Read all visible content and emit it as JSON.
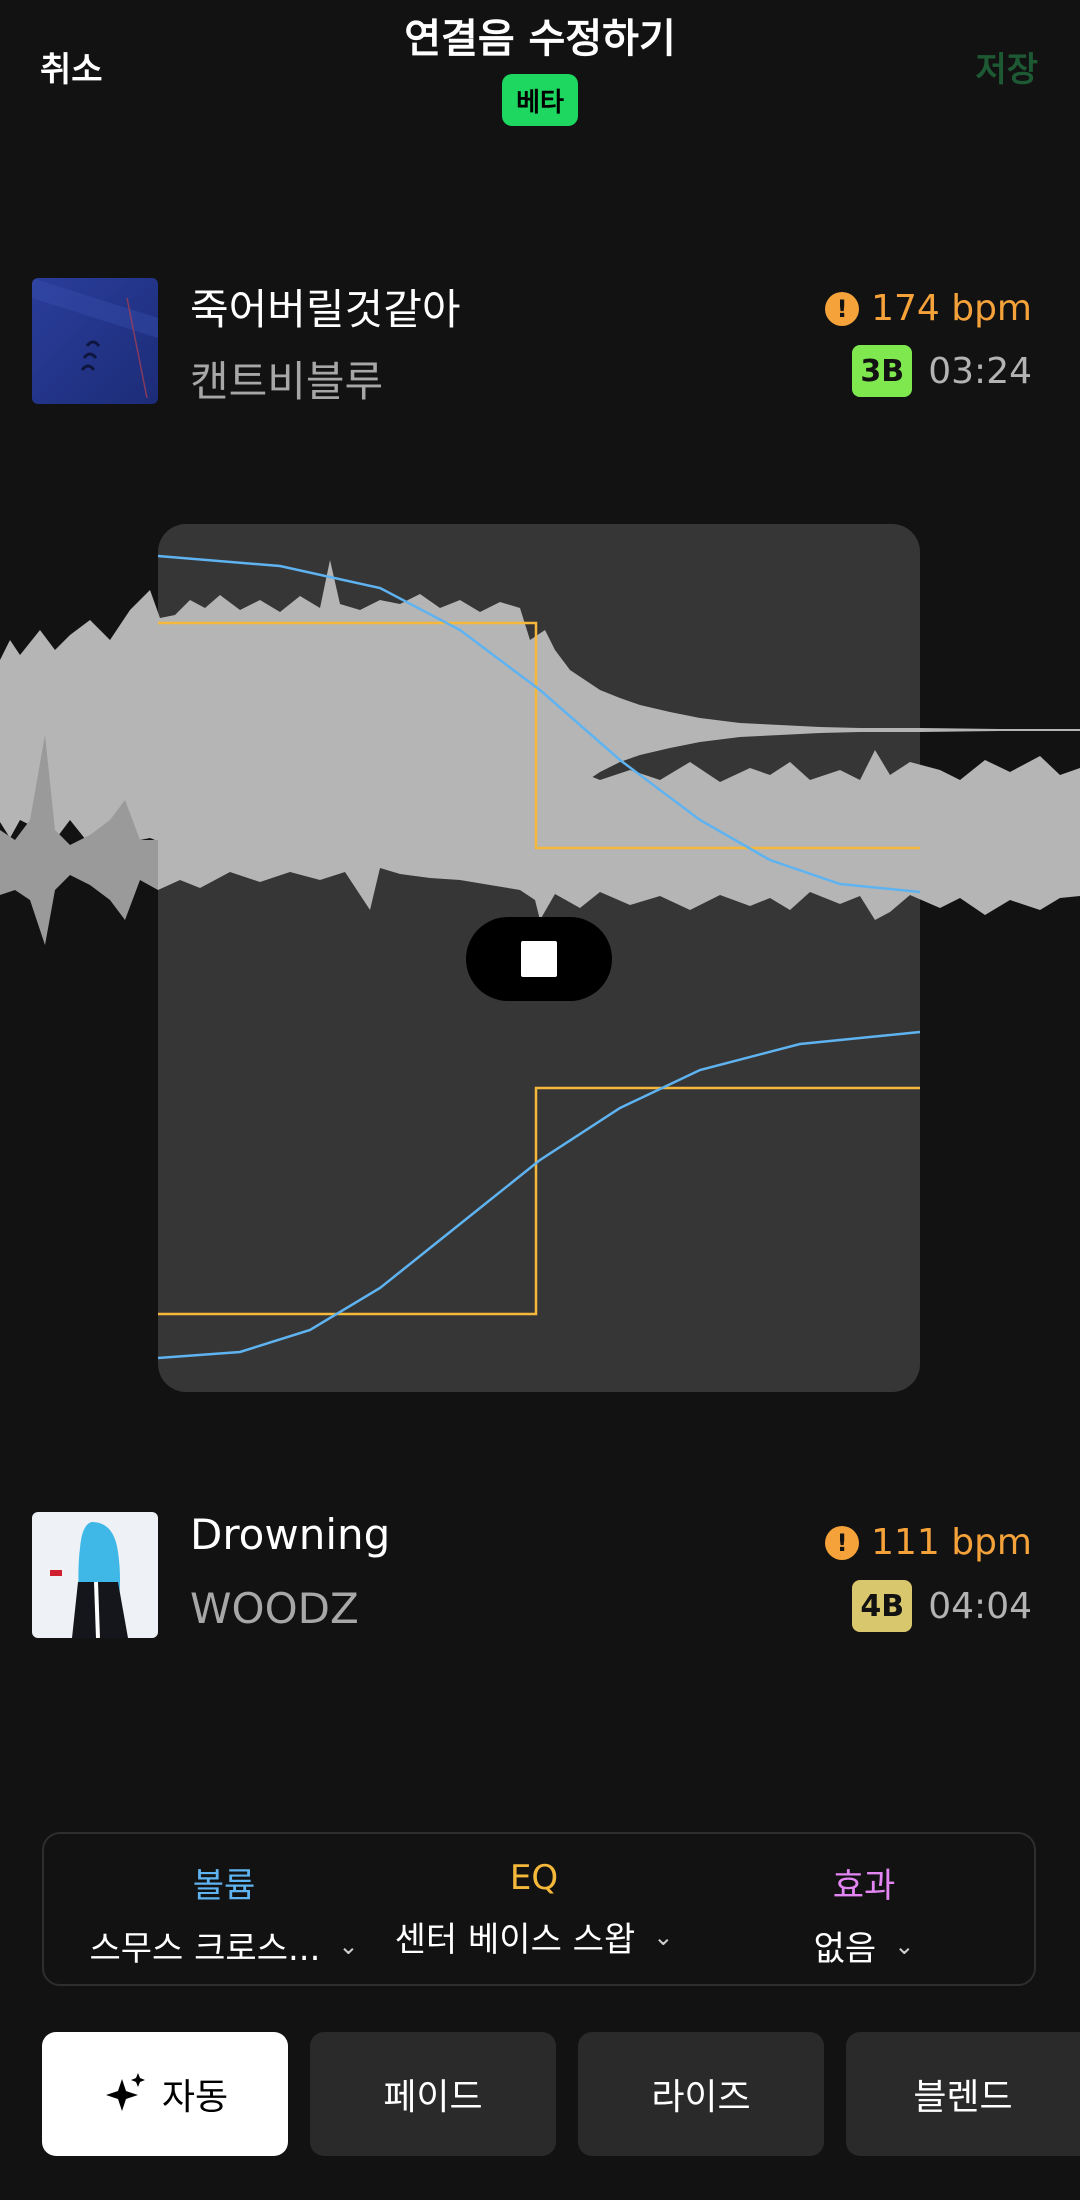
{
  "header": {
    "cancel_label": "취소",
    "title": "연결음 수정하기",
    "beta_badge": "베타",
    "save_label": "저장"
  },
  "track_from": {
    "title": "죽어버릴것같아",
    "artist": "캔트비블루",
    "bpm": "174 bpm",
    "key": "3B",
    "duration": "03:24",
    "key_color": "#7ee84e",
    "bpm_color": "#f5a23a"
  },
  "track_to": {
    "title": "Drowning",
    "artist": "WOODZ",
    "bpm": "111 bpm",
    "key": "4B",
    "duration": "04:04",
    "key_color": "#d9c76d",
    "bpm_color": "#f5a23a"
  },
  "panel": {
    "volume": {
      "label": "볼륨",
      "value": "스무스 크로스...",
      "color": "#5eb3f0"
    },
    "eq": {
      "label": "EQ",
      "value": "센터 베이스 스왑",
      "color": "#f5b83a"
    },
    "effect": {
      "label": "효과",
      "value": "없음",
      "color": "#e386f3"
    }
  },
  "modes": {
    "auto": "자동",
    "fade": "페이드",
    "rise": "라이즈",
    "blend": "블렌드"
  },
  "colors": {
    "accent": "#1ed760",
    "volume_curve": "#5eb3f0",
    "eq_curve": "#f5b83a"
  }
}
